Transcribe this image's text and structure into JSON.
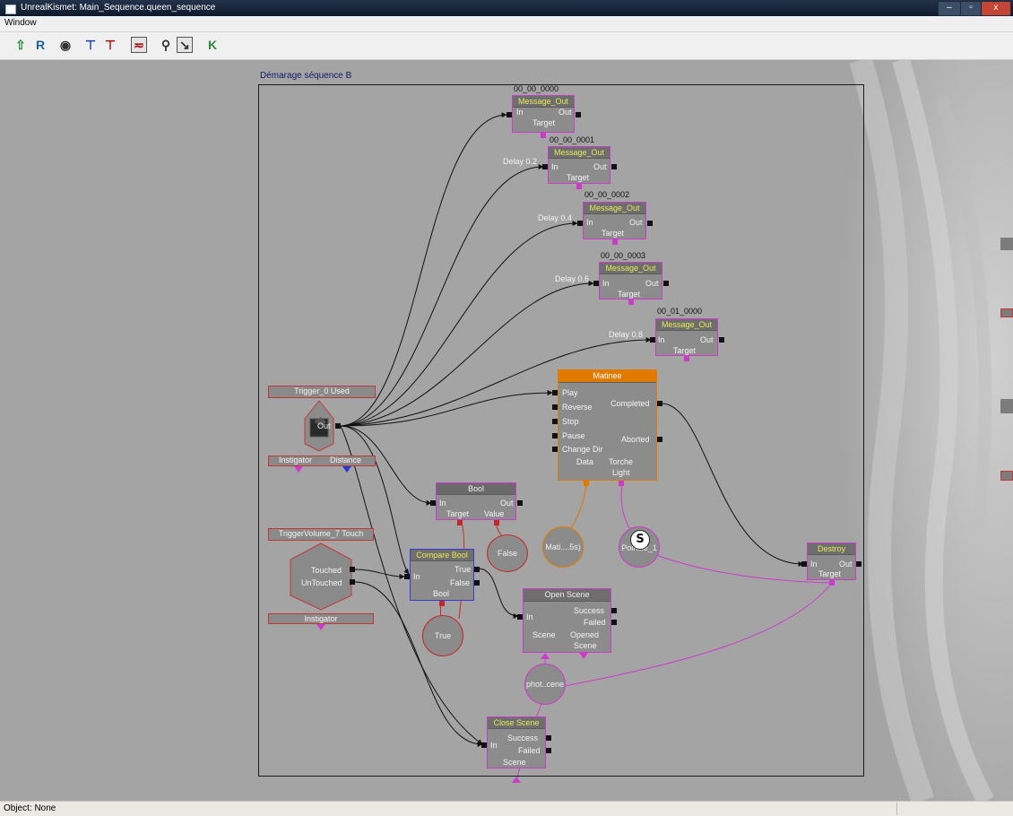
{
  "window": {
    "title": "UnrealKismet: Main_Sequence.queen_sequence",
    "btn_min": "–",
    "btn_max": "▫",
    "btn_close": "x"
  },
  "menu": {
    "window": "Window"
  },
  "toolbar": {
    "r_label": "R",
    "k_label": "K"
  },
  "sequence": {
    "title": "Démarage séquence B"
  },
  "nodes": {
    "msg0": {
      "id": "00_00_0000",
      "title": "Message_Out",
      "in": "In",
      "out": "Out",
      "target": "Target",
      "delay": ""
    },
    "msg1": {
      "id": "00_00_0001",
      "title": "Message_Out",
      "in": "In",
      "out": "Out",
      "target": "Target",
      "delay": "Delay 0.2"
    },
    "msg2": {
      "id": "00_00_0002",
      "title": "Message_Out",
      "in": "In",
      "out": "Out",
      "target": "Target",
      "delay": "Delay 0.4"
    },
    "msg3": {
      "id": "00_00_0003",
      "title": "Message_Out",
      "in": "In",
      "out": "Out",
      "target": "Target",
      "delay": "Delay 0.6"
    },
    "msg4": {
      "id": "00_01_0000",
      "title": "Message_Out",
      "in": "In",
      "out": "Out",
      "target": "Target",
      "delay": "Delay 0.8"
    },
    "matinee": {
      "title": "Matinee",
      "inputs": [
        "Play",
        "Reverse",
        "Stop",
        "Pause",
        "Change Dir"
      ],
      "completed": "Completed",
      "aborted": "Aborted",
      "data": "Data",
      "torche1": "Torche",
      "torche2": "Light"
    },
    "trigger0": {
      "title": "Trigger_0 Used",
      "out": "Out",
      "instigator": "Instigator",
      "distance": "Distance"
    },
    "triggervol": {
      "title": "TriggerVolume_7 Touch",
      "touched": "Touched",
      "untouched": "UnTouched",
      "instigator": "Instigator"
    },
    "bool": {
      "title": "Bool",
      "in": "In",
      "out": "Out",
      "target": "Target",
      "value": "Value"
    },
    "compare": {
      "title": "Compare Bool",
      "in": "In",
      "true": "True",
      "false": "False",
      "bool": "Bool"
    },
    "openscene": {
      "title": "Open Scene",
      "in": "In",
      "success": "Success",
      "failed": "Failed",
      "scene": "Scene",
      "opened1": "Opened",
      "opened2": "Scene"
    },
    "closescene": {
      "title": "Close Scene",
      "in": "In",
      "success": "Success",
      "failed": "Failed",
      "scene": "Scene"
    },
    "destroy": {
      "title": "Destroy",
      "in": "In",
      "out": "Out",
      "target": "Target"
    }
  },
  "variables": {
    "false_var": "False",
    "true_var": "True",
    "matinee_data": "Mati....5s)",
    "light_var": "Pointlle_1",
    "light_glyph": "S",
    "scene_var": "phot..cene"
  },
  "status": {
    "object": "Object: None"
  },
  "colors": {
    "link": "#cd3bcd",
    "event": "#c23838",
    "matinee": "#e07a00",
    "header_text": "#e8e855",
    "condition": "#3a3ad0"
  }
}
